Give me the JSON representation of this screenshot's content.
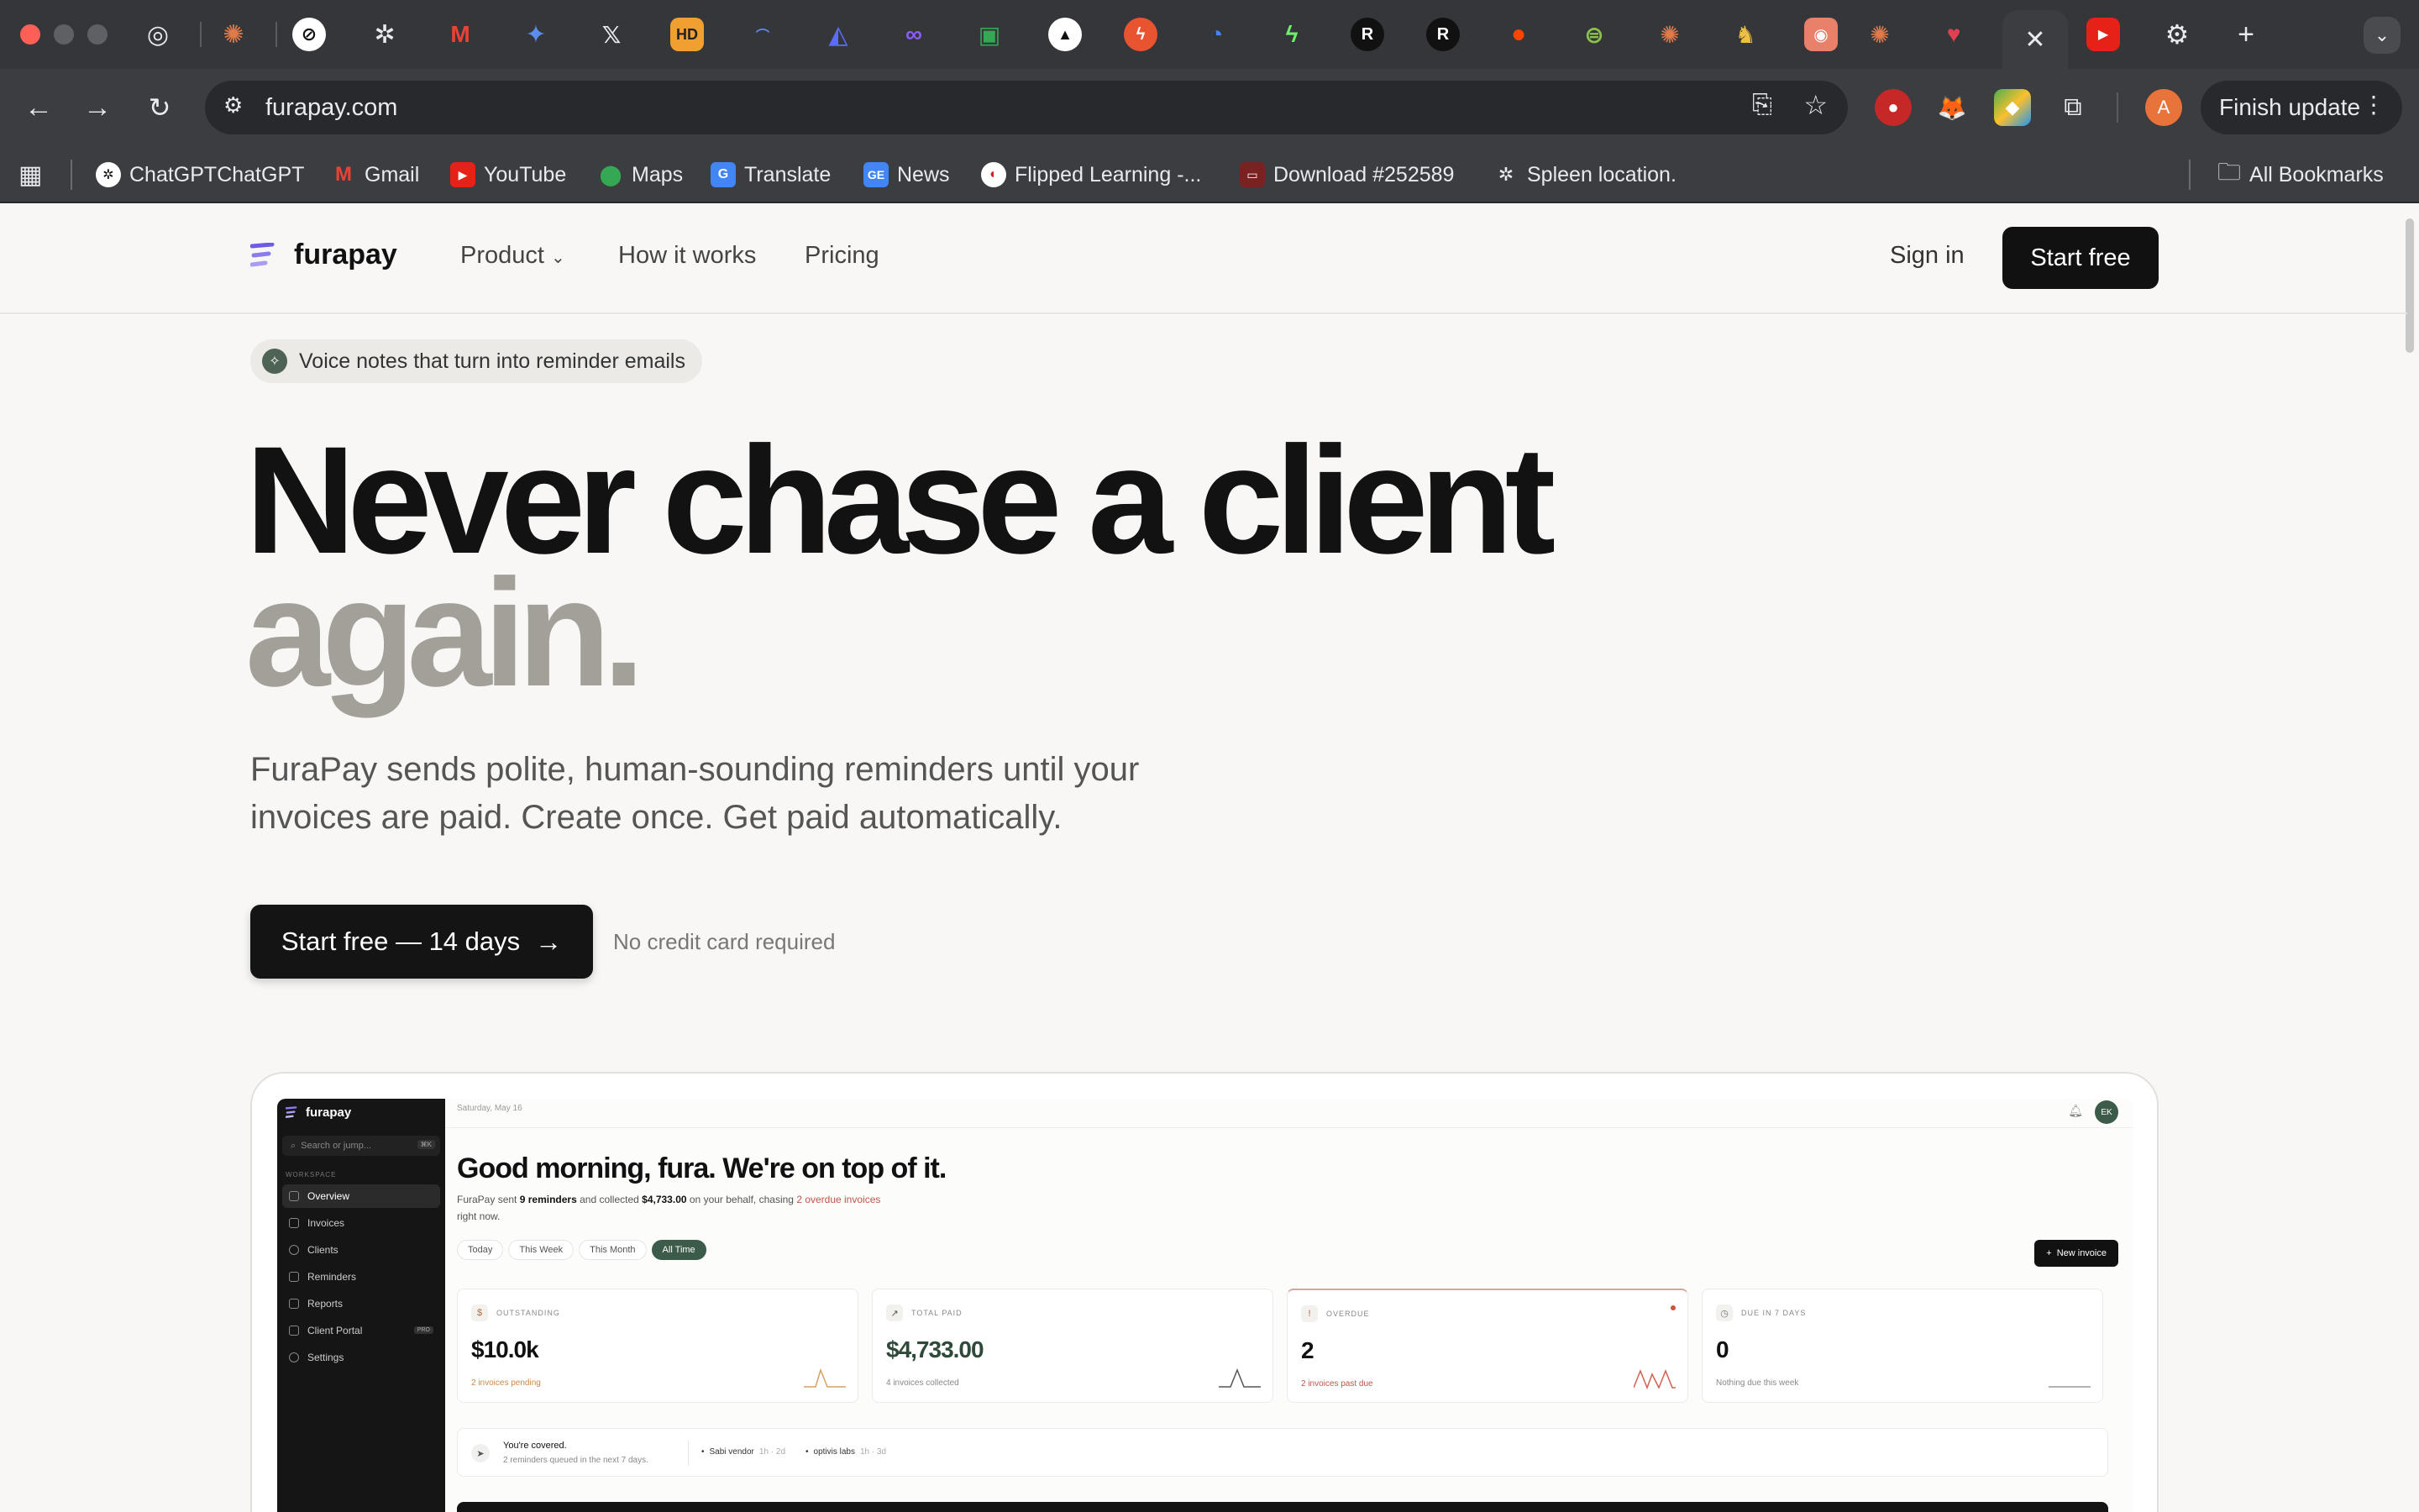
{
  "browser": {
    "url": "furapay.com",
    "finish_update": "Finish update",
    "profile_initial": "A",
    "bookmarks": [
      {
        "label": "ChatGPTChatGPT",
        "icon": "chatgpt-icon"
      },
      {
        "label": "Gmail",
        "icon": "gmail-icon"
      },
      {
        "label": "YouTube",
        "icon": "youtube-icon"
      },
      {
        "label": "Maps",
        "icon": "maps-icon"
      },
      {
        "label": "Translate",
        "icon": "translate-icon"
      },
      {
        "label": "News",
        "icon": "news-icon"
      },
      {
        "label": "Flipped Learning -...",
        "icon": "flipped-learning-icon"
      },
      {
        "label": "Download #252589",
        "icon": "download-icon"
      },
      {
        "label": "Spleen location.",
        "icon": "chatgpt-icon"
      }
    ],
    "all_bookmarks": "All Bookmarks"
  },
  "site": {
    "logo": "furapay",
    "nav": {
      "product": "Product",
      "how_it_works": "How it works",
      "pricing": "Pricing"
    },
    "sign_in": "Sign in",
    "start_free": "Start free",
    "pill": "Voice notes that turn into reminder emails",
    "headline_1": "Never chase a client",
    "headline_2": "again.",
    "subheadline": "FuraPay sends polite, human-sounding reminders until your invoices are paid. Create once. Get paid automatically.",
    "cta": "Start free — 14 days",
    "cta_note": "No credit card required"
  },
  "dashboard": {
    "logo": "furapay",
    "search_placeholder": "Search or jump...",
    "search_kbd": "⌘K",
    "section": "WORKSPACE",
    "nav": [
      "Overview",
      "Invoices",
      "Clients",
      "Reminders",
      "Reports",
      "Client Portal",
      "Settings"
    ],
    "pro_badge": "PRO",
    "date": "Saturday, May 16",
    "avatar": "EK",
    "greeting": "Good morning, fura. We're on top of it.",
    "summary": {
      "p1": "FuraPay",
      "p2": " sent ",
      "reminders": "9 reminders",
      "p3": " and collected ",
      "amount": "$4,733.00",
      "p4": " on your behalf, chasing ",
      "overdue": "2 overdue invoices",
      "p5": " right now."
    },
    "filters": [
      "Today",
      "This Week",
      "This Month",
      "All Time"
    ],
    "active_filter": "All Time",
    "new_invoice": "New invoice",
    "cards": [
      {
        "label": "OUTSTANDING",
        "value": "$10.0k",
        "note": "2 invoices pending",
        "icon": "dollar-icon"
      },
      {
        "label": "TOTAL PAID",
        "value": "$4,733.00",
        "note": "4 invoices collected",
        "icon": "trend-up-icon"
      },
      {
        "label": "OVERDUE",
        "value": "2",
        "note": "2 invoices past due",
        "icon": "alert-icon"
      },
      {
        "label": "DUE IN 7 DAYS",
        "value": "0",
        "note": "Nothing due this week",
        "icon": "clock-icon"
      }
    ],
    "covered_title": "You're covered.",
    "covered_sub": "2 reminders queued in the next 7 days.",
    "queue": [
      {
        "name": "Sabi vendor",
        "times": "1h · 2d"
      },
      {
        "name": "optivis labs",
        "times": "1h · 3d"
      }
    ]
  }
}
